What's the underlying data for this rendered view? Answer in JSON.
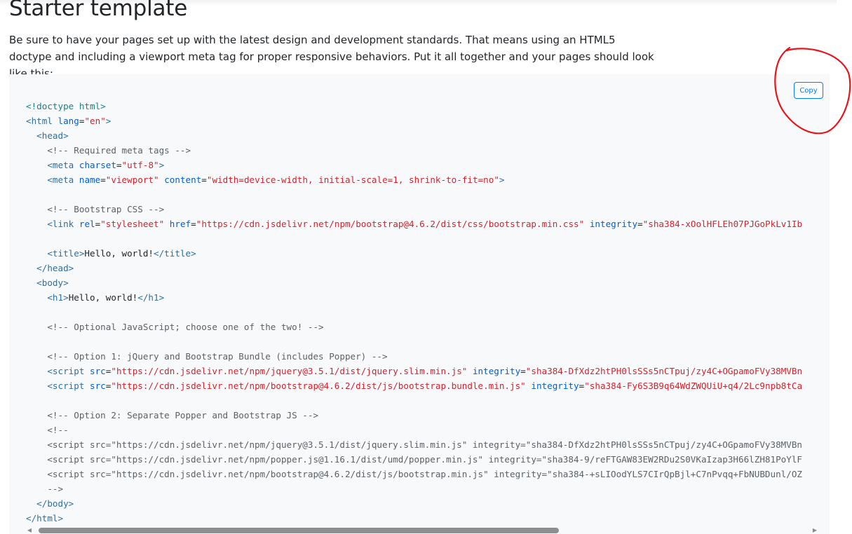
{
  "page": {
    "title": "Starter template",
    "lead": "Be sure to have your pages set up with the latest design and development standards. That means using an HTML5 doctype and including a viewport meta tag for proper responsive behaviors. Put it all together and your pages should look like this:"
  },
  "code_block": {
    "copy_label": "Copy",
    "lines": [
      [
        [
          "doc",
          "<!doctype html>"
        ]
      ],
      [
        [
          "tag",
          "<html"
        ],
        [
          "",
          " "
        ],
        [
          "attr",
          "lang"
        ],
        [
          "",
          "="
        ],
        [
          "str",
          "\"en\""
        ],
        [
          "tag",
          ">"
        ]
      ],
      [
        [
          "",
          "  "
        ],
        [
          "tag",
          "<head>"
        ]
      ],
      [
        [
          "",
          "    "
        ],
        [
          "com",
          "<!-- Required meta tags -->"
        ]
      ],
      [
        [
          "",
          "    "
        ],
        [
          "tag",
          "<meta"
        ],
        [
          "",
          " "
        ],
        [
          "attr",
          "charset"
        ],
        [
          "",
          "="
        ],
        [
          "str",
          "\"utf-8\""
        ],
        [
          "tag",
          ">"
        ]
      ],
      [
        [
          "",
          "    "
        ],
        [
          "tag",
          "<meta"
        ],
        [
          "",
          " "
        ],
        [
          "attr",
          "name"
        ],
        [
          "",
          "="
        ],
        [
          "str",
          "\"viewport\""
        ],
        [
          "",
          " "
        ],
        [
          "attr",
          "content"
        ],
        [
          "",
          "="
        ],
        [
          "str",
          "\"width=device-width, initial-scale=1, shrink-to-fit=no\""
        ],
        [
          "tag",
          ">"
        ]
      ],
      [
        [
          "",
          ""
        ]
      ],
      [
        [
          "",
          "    "
        ],
        [
          "com",
          "<!-- Bootstrap CSS -->"
        ]
      ],
      [
        [
          "",
          "    "
        ],
        [
          "tag",
          "<link"
        ],
        [
          "",
          " "
        ],
        [
          "attr",
          "rel"
        ],
        [
          "",
          "="
        ],
        [
          "str",
          "\"stylesheet\""
        ],
        [
          "",
          " "
        ],
        [
          "attr",
          "href"
        ],
        [
          "",
          "="
        ],
        [
          "str",
          "\"https://cdn.jsdelivr.net/npm/bootstrap@4.6.2/dist/css/bootstrap.min.css\""
        ],
        [
          "",
          " "
        ],
        [
          "attr",
          "integrity"
        ],
        [
          "",
          "="
        ],
        [
          "str",
          "\"sha384-xOolHFLEh07PJGoPkLv1Ib"
        ]
      ],
      [
        [
          "",
          ""
        ]
      ],
      [
        [
          "",
          "    "
        ],
        [
          "tag",
          "<title>"
        ],
        [
          "",
          "Hello, world!"
        ],
        [
          "tag",
          "</title>"
        ]
      ],
      [
        [
          "",
          "  "
        ],
        [
          "tag",
          "</head>"
        ]
      ],
      [
        [
          "",
          "  "
        ],
        [
          "tag",
          "<body>"
        ]
      ],
      [
        [
          "",
          "    "
        ],
        [
          "tag",
          "<h1>"
        ],
        [
          "",
          "Hello, world!"
        ],
        [
          "tag",
          "</h1>"
        ]
      ],
      [
        [
          "",
          ""
        ]
      ],
      [
        [
          "",
          "    "
        ],
        [
          "com",
          "<!-- Optional JavaScript; choose one of the two! -->"
        ]
      ],
      [
        [
          "",
          ""
        ]
      ],
      [
        [
          "",
          "    "
        ],
        [
          "com",
          "<!-- Option 1: jQuery and Bootstrap Bundle (includes Popper) -->"
        ]
      ],
      [
        [
          "",
          "    "
        ],
        [
          "tag",
          "<script"
        ],
        [
          "",
          " "
        ],
        [
          "attr",
          "src"
        ],
        [
          "",
          "="
        ],
        [
          "str",
          "\"https://cdn.jsdelivr.net/npm/jquery@3.5.1/dist/jquery.slim.min.js\""
        ],
        [
          "",
          " "
        ],
        [
          "attr",
          "integrity"
        ],
        [
          "",
          "="
        ],
        [
          "str",
          "\"sha384-DfXdz2htPH0lsSSs5nCTpuj/zy4C+OGpamoFVy38MVBn"
        ]
      ],
      [
        [
          "",
          "    "
        ],
        [
          "tag",
          "<script"
        ],
        [
          "",
          " "
        ],
        [
          "attr",
          "src"
        ],
        [
          "",
          "="
        ],
        [
          "str",
          "\"https://cdn.jsdelivr.net/npm/bootstrap@4.6.2/dist/js/bootstrap.bundle.min.js\""
        ],
        [
          "",
          " "
        ],
        [
          "attr",
          "integrity"
        ],
        [
          "",
          "="
        ],
        [
          "str",
          "\"sha384-Fy6S3B9q64WdZWQUiU+q4/2Lc9npb8tCa"
        ]
      ],
      [
        [
          "",
          ""
        ]
      ],
      [
        [
          "",
          "    "
        ],
        [
          "com",
          "<!-- Option 2: Separate Popper and Bootstrap JS -->"
        ]
      ],
      [
        [
          "",
          "    "
        ],
        [
          "com",
          "<!--"
        ]
      ],
      [
        [
          "",
          "    "
        ],
        [
          "com",
          "<script src=\"https://cdn.jsdelivr.net/npm/jquery@3.5.1/dist/jquery.slim.min.js\" integrity=\"sha384-DfXdz2htPH0lsSSs5nCTpuj/zy4C+OGpamoFVy38MVBn"
        ]
      ],
      [
        [
          "",
          "    "
        ],
        [
          "com",
          "<script src=\"https://cdn.jsdelivr.net/npm/popper.js@1.16.1/dist/umd/popper.min.js\" integrity=\"sha384-9/reFTGAW83EW2RDu2S0VKaIzap3H66lZH81PoYlF"
        ]
      ],
      [
        [
          "",
          "    "
        ],
        [
          "com",
          "<script src=\"https://cdn.jsdelivr.net/npm/bootstrap@4.6.2/dist/js/bootstrap.min.js\" integrity=\"sha384-+sLIOodYLS7CIrQpBjl+C7nPvqq+FbNUBDunl/OZ"
        ]
      ],
      [
        [
          "",
          "    "
        ],
        [
          "com",
          "-->"
        ]
      ],
      [
        [
          "",
          "  "
        ],
        [
          "tag",
          "</body>"
        ]
      ],
      [
        [
          "tag",
          "</html>"
        ]
      ]
    ]
  },
  "scrollbar": {
    "left_arrow_icon": "triangle-left-icon",
    "right_arrow_icon": "triangle-right-icon",
    "thumb_fraction": 0.66,
    "position_fraction": 0
  },
  "annotation": {
    "shape": "hand-drawn-circle",
    "color": "#e8141c"
  }
}
